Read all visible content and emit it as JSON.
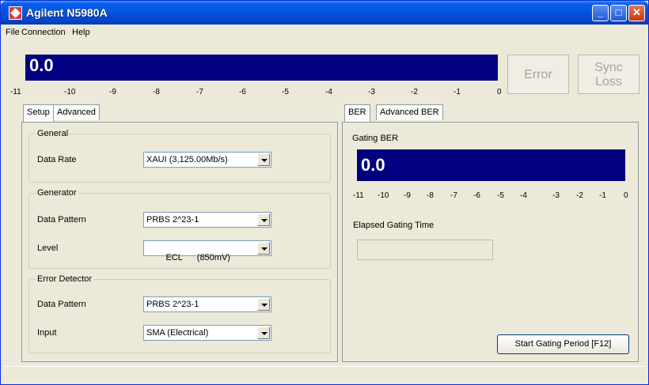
{
  "window": {
    "title": "Agilent N5980A",
    "min_label": "_",
    "max_label": "□",
    "close_label": "✕"
  },
  "menu": [
    "File",
    "Connection",
    "Help"
  ],
  "top_meter": {
    "value": "0.0",
    "scale": [
      "-11",
      "-10",
      "-9",
      "-8",
      "-7",
      "-6",
      "-5",
      "-4",
      "-3",
      "-2",
      "-1",
      "0"
    ],
    "error_label": "Error",
    "sync_label_1": "Sync",
    "sync_label_2": "Loss"
  },
  "left_tabs": {
    "setup": "Setup",
    "advanced": "Advanced"
  },
  "general": {
    "title": "General",
    "data_rate_label": "Data Rate",
    "data_rate_value": "XAUI (3,125.00Mb/s)"
  },
  "generator": {
    "title": "Generator",
    "pattern_label": "Data Pattern",
    "pattern_value": "PRBS 2^23-1",
    "level_label": "Level",
    "level_value": "ECL      (850mV)"
  },
  "error_detector": {
    "title": "Error Detector",
    "pattern_label": "Data Pattern",
    "pattern_value": "PRBS 2^23-1",
    "input_label": "Input",
    "input_value": "SMA (Electrical)"
  },
  "right_tabs": {
    "ber": "BER",
    "advanced_ber": "Advanced BER"
  },
  "gating": {
    "title": "Gating BER",
    "value": "0.0",
    "scale": [
      "-11",
      "-10",
      "-9",
      "-8",
      "-7",
      "-6",
      "-5",
      "-4",
      "-3",
      "-2",
      "-1",
      "0"
    ],
    "elapsed_label": "Elapsed Gating Time",
    "elapsed_value": "",
    "start_button": "Start Gating Period  [F12]"
  },
  "colors": {
    "meter": "#000080",
    "titlebar": "#0552de"
  }
}
